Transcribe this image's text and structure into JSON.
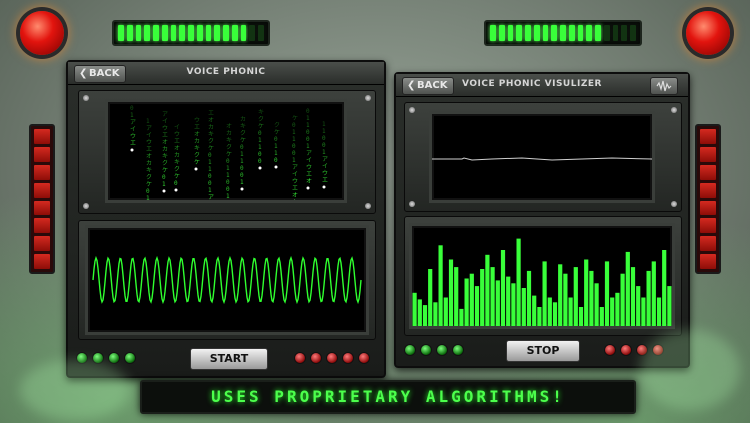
{
  "left_panel": {
    "back_label": "BACK",
    "title": "VOICE PHONIC",
    "start_label": "START",
    "green_leds": 4,
    "red_leds": 5
  },
  "right_panel": {
    "back_label": "BACK",
    "title": "VOICE PHONIC VISULIZER",
    "stop_label": "STOP",
    "green_leds": 4,
    "red_leds": 4,
    "spectrum_levels": [
      0.35,
      0.28,
      0.22,
      0.6,
      0.25,
      0.85,
      0.3,
      0.7,
      0.62,
      0.18,
      0.5,
      0.55,
      0.42,
      0.6,
      0.75,
      0.62,
      0.48,
      0.8,
      0.52,
      0.45,
      0.92,
      0.4,
      0.58,
      0.32,
      0.2,
      0.68,
      0.3,
      0.25,
      0.65,
      0.55,
      0.3,
      0.62,
      0.2,
      0.7,
      0.58,
      0.45,
      0.2,
      0.68,
      0.3,
      0.35,
      0.55,
      0.78,
      0.62,
      0.42,
      0.3,
      0.58,
      0.68,
      0.3,
      0.8,
      0.42
    ]
  },
  "meters": {
    "left_active": 15,
    "left_total": 17,
    "right_active": 13,
    "right_total": 17
  },
  "side_bars": 8,
  "colors": {
    "led_green": "#39ff3a",
    "lamp_red": "#e2140e",
    "bar_red": "#d52a20"
  },
  "banner_text": "USES PROPRIETARY ALGORITHMS!"
}
